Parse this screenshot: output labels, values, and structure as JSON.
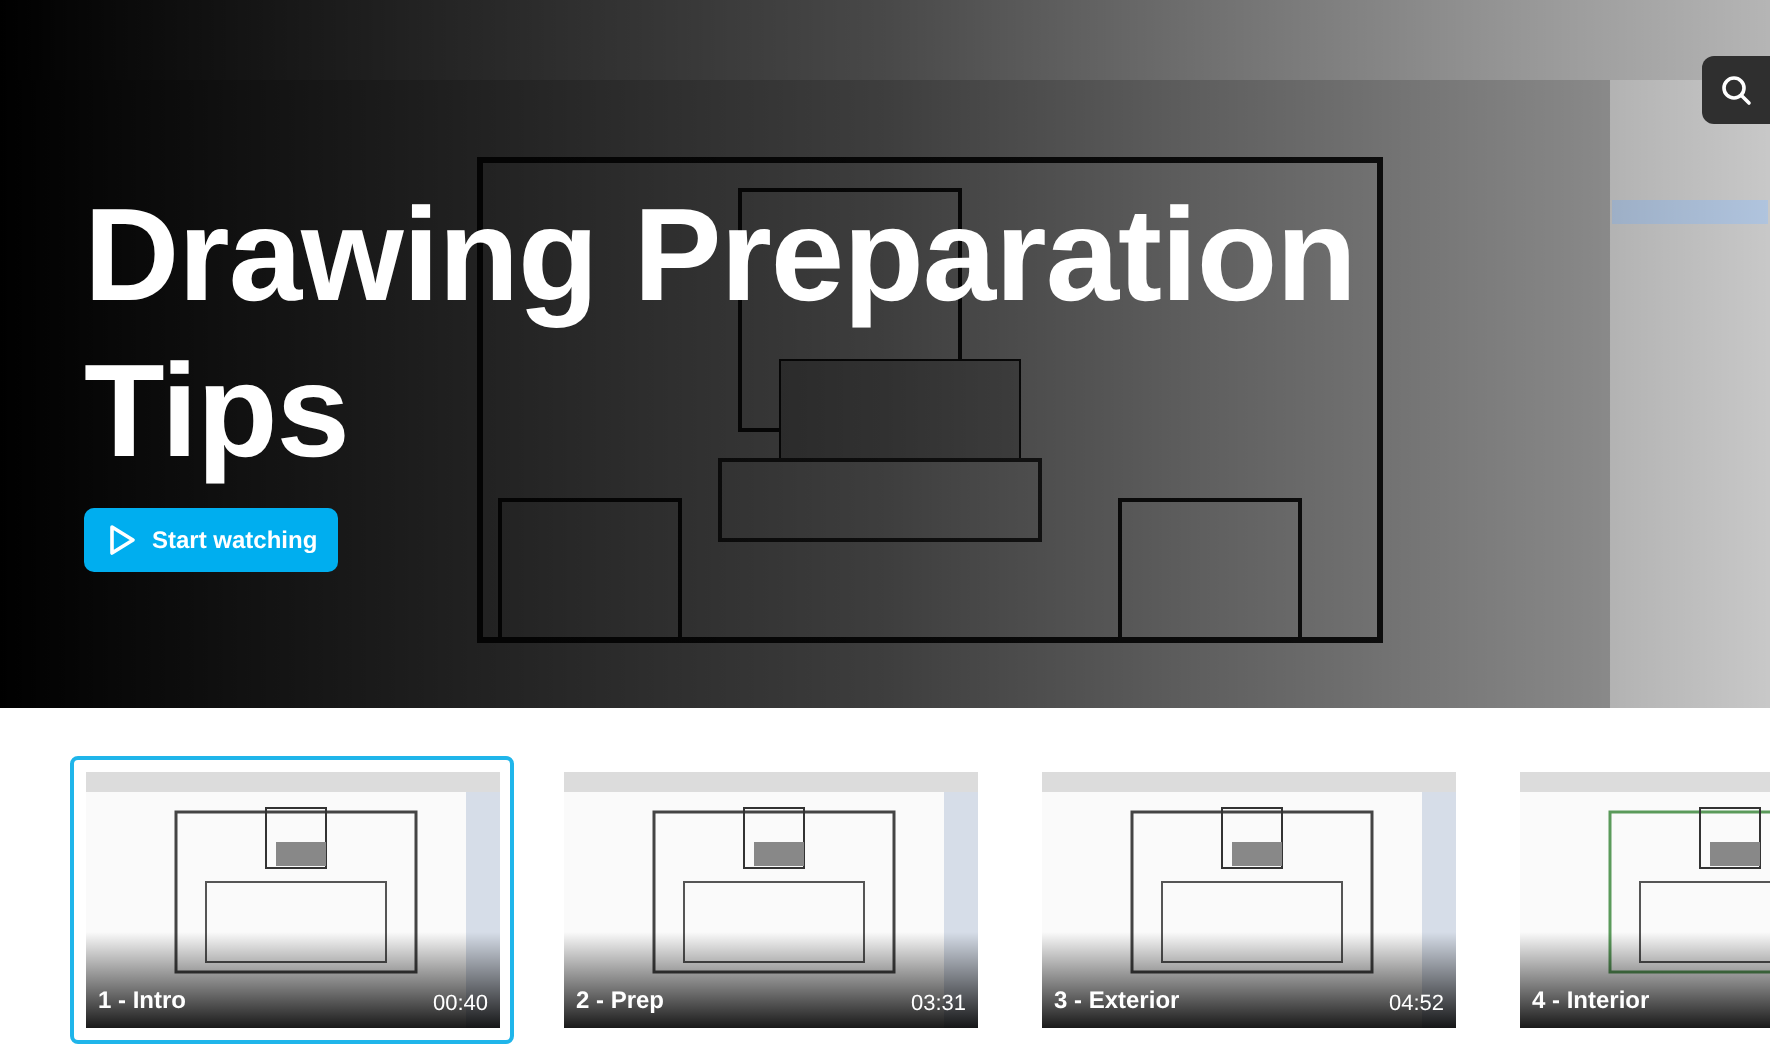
{
  "hero": {
    "kind": "picture",
    "title": "Drawing Preparation Tips",
    "button": "Start watching"
  },
  "videos": [
    {
      "title": "1 - Intro",
      "duration": "00:40",
      "selected": true
    },
    {
      "title": "2 - Prep",
      "duration": "03:31",
      "selected": false
    },
    {
      "title": "3 - Exterior",
      "duration": "04:52",
      "selected": false
    },
    {
      "title": "4 - Interior",
      "selected": false
    }
  ]
}
